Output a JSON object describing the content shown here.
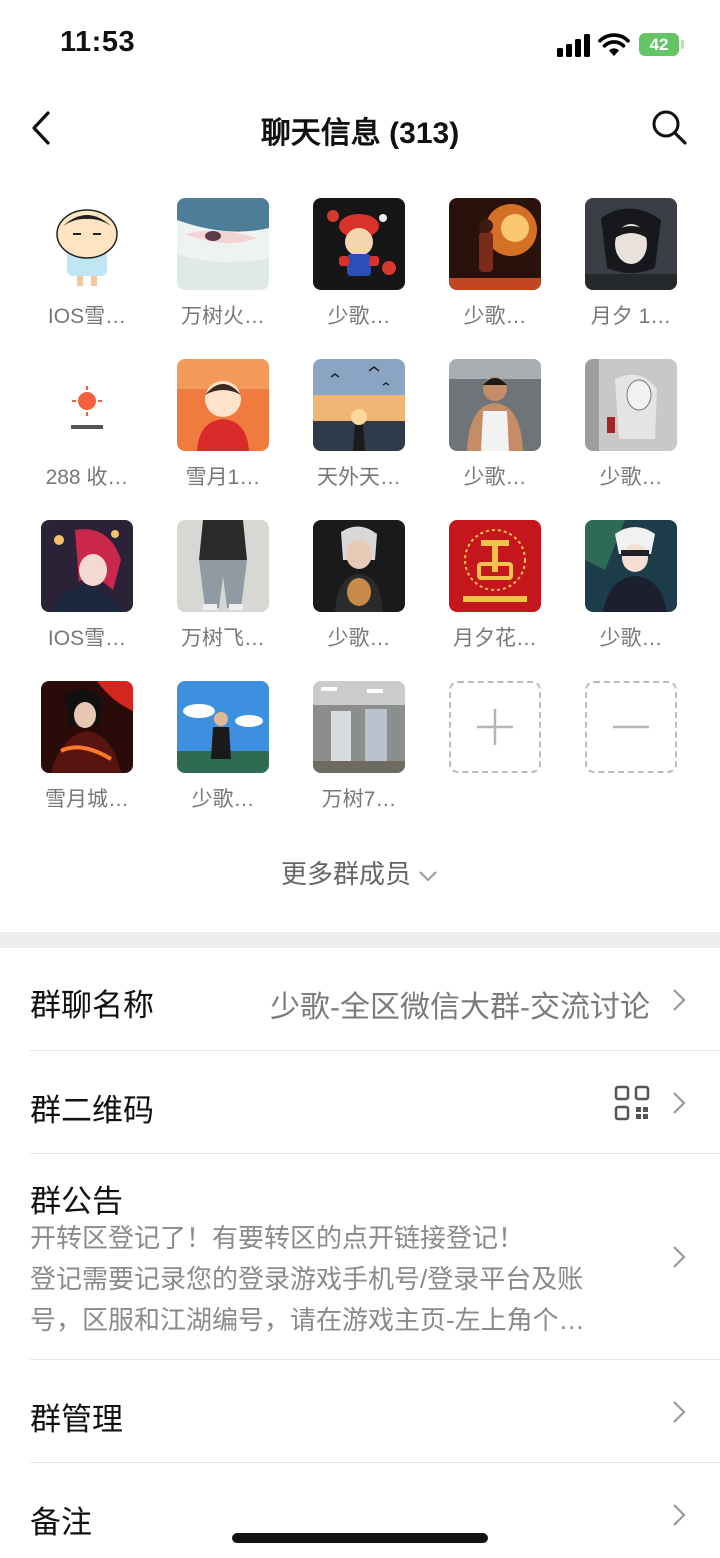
{
  "status_bar": {
    "time": "11:53",
    "battery": "42"
  },
  "nav": {
    "title": "聊天信息 (313)"
  },
  "members": [
    {
      "name": "IOS雪…",
      "avatar": "cartoon-boy-avatar"
    },
    {
      "name": "万树火…",
      "avatar": "anime-girl-eye-avatar"
    },
    {
      "name": "少歌…",
      "avatar": "mario-avatar"
    },
    {
      "name": "少歌…",
      "avatar": "fireworks-avatar"
    },
    {
      "name": "月夕 1…",
      "avatar": "anime-dark-hair-avatar"
    },
    {
      "name": "288 收…",
      "avatar": "sun-smile-avatar"
    },
    {
      "name": "雪月1…",
      "avatar": "cartoon-red-boy-avatar"
    },
    {
      "name": "天外天…",
      "avatar": "sunset-birds-avatar"
    },
    {
      "name": "少歌…",
      "avatar": "gym-man-avatar"
    },
    {
      "name": "少歌…",
      "avatar": "sketch-art-avatar"
    },
    {
      "name": "IOS雪…",
      "avatar": "anime-red-hair-avatar"
    },
    {
      "name": "万树飞…",
      "avatar": "jeans-photo-avatar"
    },
    {
      "name": "少歌…",
      "avatar": "dog-portrait-avatar"
    },
    {
      "name": "月夕花…",
      "avatar": "red-fortune-avatar"
    },
    {
      "name": "少歌…",
      "avatar": "anime-white-hair-avatar"
    },
    {
      "name": "雪月城…",
      "avatar": "anime-warrior-avatar"
    },
    {
      "name": "少歌…",
      "avatar": "blue-sky-boy-avatar"
    },
    {
      "name": "万树7…",
      "avatar": "factory-photo-avatar"
    }
  ],
  "more_members_label": "更多群成员",
  "settings": {
    "group_name": {
      "label": "群聊名称",
      "value": "少歌-全区微信大群-交流讨论"
    },
    "qr_code": {
      "label": "群二维码"
    },
    "notice": {
      "label": "群公告",
      "lines": [
        "开转区登记了！有要转区的点开链接登记！",
        "登记需要记录您的登录游戏手机号/登录平台及账",
        "号，区服和江湖编号，请在游戏主页-左上角个…"
      ]
    },
    "manage": {
      "label": "群管理"
    },
    "remark": {
      "label": "备注"
    }
  }
}
